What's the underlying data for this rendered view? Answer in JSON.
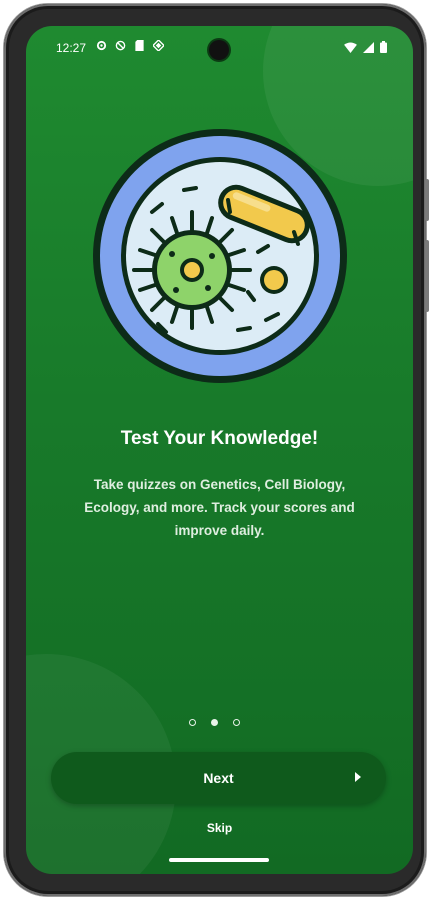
{
  "status_bar": {
    "time": "12:27",
    "left_icons": [
      "settings-icon",
      "block-icon",
      "sim-icon",
      "data-saver-icon"
    ],
    "right_icons": [
      "wifi-icon",
      "signal-icon",
      "battery-icon"
    ]
  },
  "onboarding": {
    "illustration": "cell-bacteria-illustration",
    "title": "Test Your Knowledge!",
    "description": "Take quizzes on Genetics, Cell Biology, Ecology, and more. Track your scores and improve daily.",
    "page_count": 3,
    "current_page": 2,
    "next_label": "Next",
    "skip_label": "Skip"
  },
  "colors": {
    "background": "#1b7f2c",
    "button": "#0f5a1c",
    "text": "#ffffff"
  }
}
